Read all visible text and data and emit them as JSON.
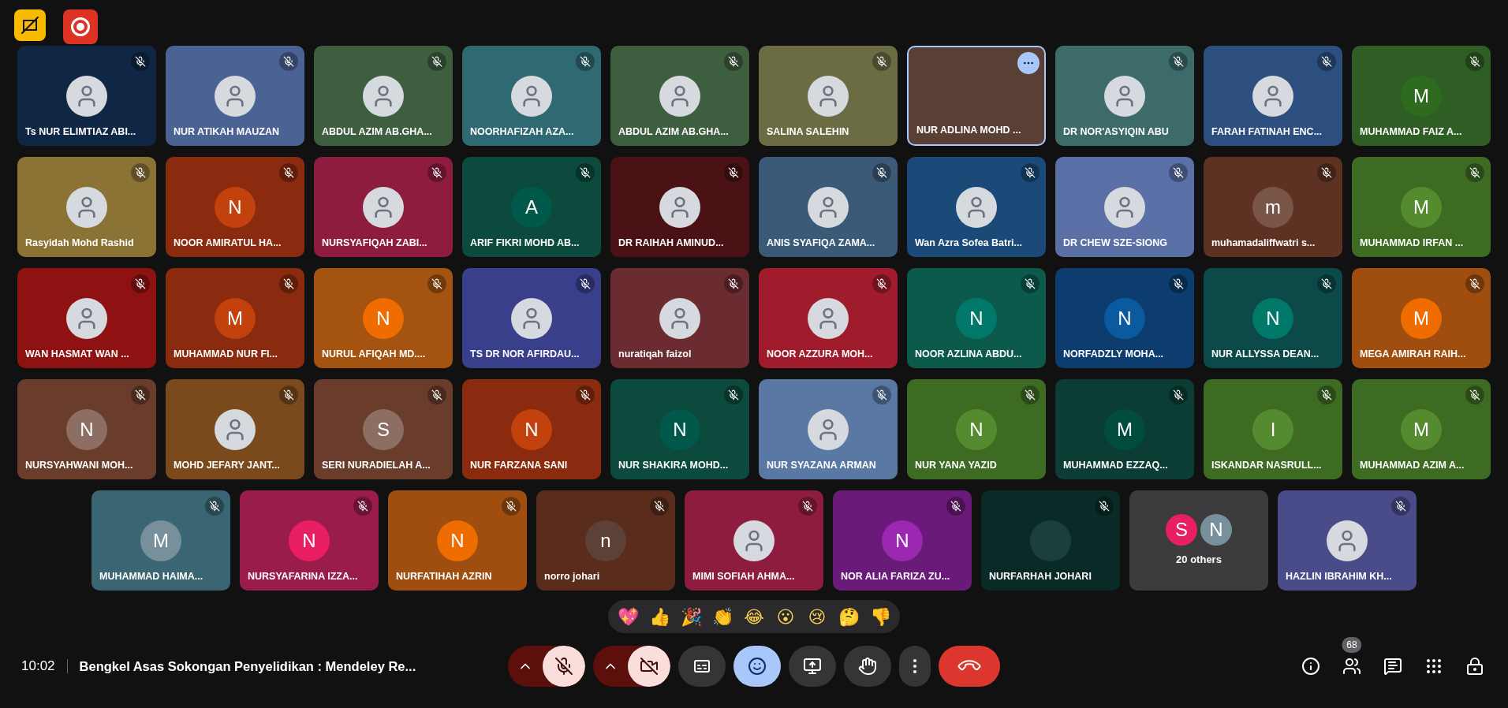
{
  "top_indicators": [
    {
      "kind": "crossed"
    },
    {
      "kind": "record"
    }
  ],
  "tiles": [
    {
      "kind": "photo",
      "name": "Ts NUR ELIMTIAZ ABI...",
      "color": "#0f2744",
      "muted": true
    },
    {
      "kind": "photo",
      "name": "NUR ATIKAH MAUZAN",
      "color": "#4a6394",
      "muted": true
    },
    {
      "kind": "photo",
      "name": "ABDUL AZIM AB.GHA...",
      "color": "#3e5e40",
      "muted": true
    },
    {
      "kind": "photo",
      "name": "NOORHAFIZAH AZA...",
      "color": "#2f6a72",
      "muted": true
    },
    {
      "kind": "photo",
      "name": "ABDUL AZIM AB.GHA...",
      "color": "#3e5e40",
      "muted": true
    },
    {
      "kind": "photo",
      "name": "SALINA SALEHIN",
      "color": "#6b6b44",
      "muted": true
    },
    {
      "kind": "video",
      "name": "NUR ADLINA MOHD ...",
      "color": "#5a4034"
    },
    {
      "kind": "photo",
      "name": "DR NOR'ASYIQIN ABU",
      "color": "#3d6b6a",
      "muted": true
    },
    {
      "kind": "photo",
      "name": "FARAH FATINAH ENC...",
      "color": "#2c4f80",
      "muted": true
    },
    {
      "kind": "letter",
      "name": "MUHAMMAD FAIZ A...",
      "color": "#2f5e25",
      "avatar": {
        "letter": "M",
        "color": "#2e6b1f"
      },
      "muted": true
    },
    {
      "kind": "photo",
      "name": "Rasyidah Mohd Rashid",
      "color": "#8a7335",
      "muted": true
    },
    {
      "kind": "letter",
      "name": "NOOR AMIRATUL HA...",
      "color": "#8a2a0e",
      "avatar": {
        "letter": "N",
        "color": "#c2410c"
      },
      "muted": true
    },
    {
      "kind": "photo",
      "name": "NURSYAFIQAH ZABI...",
      "color": "#8e1c3e",
      "muted": true
    },
    {
      "kind": "letter",
      "name": "ARIF FIKRI MOHD AB...",
      "color": "#0b4a3c",
      "avatar": {
        "letter": "A",
        "color": "#00594a"
      },
      "muted": true
    },
    {
      "kind": "photo",
      "name": "DR RAIHAH AMINUD...",
      "color": "#4a1214",
      "muted": true
    },
    {
      "kind": "photo",
      "name": "ANIS SYAFIQA ZAMA...",
      "color": "#3b5a78",
      "muted": true
    },
    {
      "kind": "photo",
      "name": "Wan Azra Sofea Batri...",
      "color": "#1c4a78",
      "muted": true
    },
    {
      "kind": "photo",
      "name": "DR CHEW SZE-SIONG",
      "color": "#5a70a6",
      "muted": true
    },
    {
      "kind": "letter",
      "name": "muhamadaliffwatri s...",
      "color": "#5e3222",
      "avatar": {
        "letter": "m",
        "color": "#795548"
      },
      "muted": true
    },
    {
      "kind": "letter",
      "name": "MUHAMMAD IRFAN ...",
      "color": "#3d6b22",
      "avatar": {
        "letter": "M",
        "color": "#558b2f"
      },
      "muted": true
    },
    {
      "kind": "photo",
      "name": "WAN HASMAT WAN ...",
      "color": "#8e1212",
      "muted": true
    },
    {
      "kind": "letter",
      "name": "MUHAMMAD NUR FI...",
      "color": "#8a2a0e",
      "avatar": {
        "letter": "M",
        "color": "#c2410c"
      },
      "muted": true
    },
    {
      "kind": "letter",
      "name": "NURUL AFIQAH MD....",
      "color": "#a45410",
      "avatar": {
        "letter": "N",
        "color": "#ef6c00"
      },
      "muted": true
    },
    {
      "kind": "photo",
      "name": "TS DR NOR AFIRDAU...",
      "color": "#3a3f8c",
      "muted": true
    },
    {
      "kind": "photo",
      "name": "nuratiqah faizol",
      "color": "#6a2c30",
      "muted": true
    },
    {
      "kind": "photo",
      "name": "NOOR AZZURA MOH...",
      "color": "#a01c2c",
      "muted": true
    },
    {
      "kind": "letter",
      "name": "NOOR AZLINA ABDU...",
      "color": "#0b5a4c",
      "avatar": {
        "letter": "N",
        "color": "#00796b"
      },
      "muted": true
    },
    {
      "kind": "letter",
      "name": "NORFADZLY MOHA...",
      "color": "#0c3d6e",
      "avatar": {
        "letter": "N",
        "color": "#0b5aa0"
      },
      "muted": true
    },
    {
      "kind": "letter",
      "name": "NUR ALLYSSA DEAN...",
      "color": "#0b4a48",
      "avatar": {
        "letter": "N",
        "color": "#00796b"
      },
      "muted": true
    },
    {
      "kind": "letter",
      "name": "MEGA AMIRAH RAIH...",
      "color": "#a04e10",
      "avatar": {
        "letter": "M",
        "color": "#ef6c00"
      },
      "muted": true
    },
    {
      "kind": "letter",
      "name": "NURSYAHWANI MOH...",
      "color": "#6a3c2c",
      "avatar": {
        "letter": "N",
        "color": "#8d6e63"
      },
      "muted": true
    },
    {
      "kind": "photo",
      "name": "MOHD JEFARY JANT...",
      "color": "#7a4a1c",
      "muted": true
    },
    {
      "kind": "letter",
      "name": "SERI NURADIELAH A...",
      "color": "#6a3c2c",
      "avatar": {
        "letter": "S",
        "color": "#8d6e63"
      },
      "muted": true
    },
    {
      "kind": "letter",
      "name": "NUR FARZANA SANI",
      "color": "#8a2a0e",
      "avatar": {
        "letter": "N",
        "color": "#c2410c"
      },
      "muted": true
    },
    {
      "kind": "letter",
      "name": "NUR SHAKIRA MOHD...",
      "color": "#0b4a3c",
      "avatar": {
        "letter": "N",
        "color": "#00594a"
      },
      "muted": true
    },
    {
      "kind": "photo",
      "name": "NUR SYAZANA ARMAN",
      "color": "#5a78a4",
      "muted": true
    },
    {
      "kind": "letter",
      "name": "NUR YANA YAZID",
      "color": "#3d6b22",
      "avatar": {
        "letter": "N",
        "color": "#558b2f"
      },
      "muted": true
    },
    {
      "kind": "letter",
      "name": "MUHAMMAD EZZAQ...",
      "color": "#0b3d34",
      "avatar": {
        "letter": "M",
        "color": "#004d40"
      },
      "muted": true
    },
    {
      "kind": "letter",
      "name": "ISKANDAR NASRULL...",
      "color": "#3d6b22",
      "avatar": {
        "letter": "I",
        "color": "#558b2f"
      },
      "muted": true
    },
    {
      "kind": "letter",
      "name": "MUHAMMAD AZIM A...",
      "color": "#3d6b22",
      "avatar": {
        "letter": "M",
        "color": "#558b2f"
      },
      "muted": true
    },
    {
      "kind": "letter",
      "name": "MUHAMMAD HAIMA...",
      "color": "#3a6674",
      "avatar": {
        "letter": "M",
        "color": "#78909c"
      },
      "muted": true
    },
    {
      "kind": "letter",
      "name": "NURSYAFARINA IZZA...",
      "color": "#9a1c4a",
      "avatar": {
        "letter": "N",
        "color": "#e91e63"
      },
      "muted": true
    },
    {
      "kind": "letter",
      "name": "NURFATIHAH AZRIN",
      "color": "#a04e10",
      "avatar": {
        "letter": "N",
        "color": "#ef6c00"
      },
      "muted": true
    },
    {
      "kind": "letter",
      "name": "norro johari",
      "color": "#5a2c1c",
      "avatar": {
        "letter": "n",
        "color": "#5d4037"
      },
      "muted": true
    },
    {
      "kind": "photo",
      "name": "MIMI SOFIAH AHMA...",
      "color": "#8e1c3e",
      "muted": true
    },
    {
      "kind": "letter",
      "name": "NOR ALIA FARIZA ZU...",
      "color": "#6a1a78",
      "avatar": {
        "letter": "N",
        "color": "#9c27b0"
      },
      "muted": true
    },
    {
      "kind": "blank",
      "name": "NURFARHAH JOHARI",
      "color": "#0a2a28",
      "avatar": {
        "color": "#1a3f3c"
      },
      "muted": true
    },
    {
      "kind": "others",
      "name": "20 others",
      "color": "#3c3c3f",
      "avatars": [
        {
          "letter": "S",
          "color": "#e91e63"
        },
        {
          "letter": "N",
          "color": "#78909c"
        }
      ]
    },
    {
      "kind": "photo",
      "name": "HAZLIN IBRAHIM KH...",
      "color": "#4a4c8a",
      "muted": true
    }
  ],
  "reactions": [
    "💖",
    "👍",
    "🎉",
    "👏",
    "😂",
    "😮",
    "😢",
    "🤔",
    "👎"
  ],
  "meeting": {
    "time": "10:02",
    "title": "Bengkel Asas Sokongan Penyelidikan : Mendeley Re..."
  },
  "controls": [
    {
      "kind": "mic",
      "on": false
    },
    {
      "kind": "camera",
      "on": false
    },
    {
      "kind": "captions",
      "on": false
    },
    {
      "kind": "reactions",
      "on": true
    },
    {
      "kind": "present",
      "on": false
    },
    {
      "kind": "hand",
      "on": false
    },
    {
      "kind": "more",
      "on": false
    },
    {
      "kind": "leave",
      "on": false
    }
  ],
  "side_buttons": [
    {
      "kind": "info"
    },
    {
      "kind": "people",
      "badge": "68"
    },
    {
      "kind": "chat"
    },
    {
      "kind": "activities"
    },
    {
      "kind": "host"
    }
  ]
}
